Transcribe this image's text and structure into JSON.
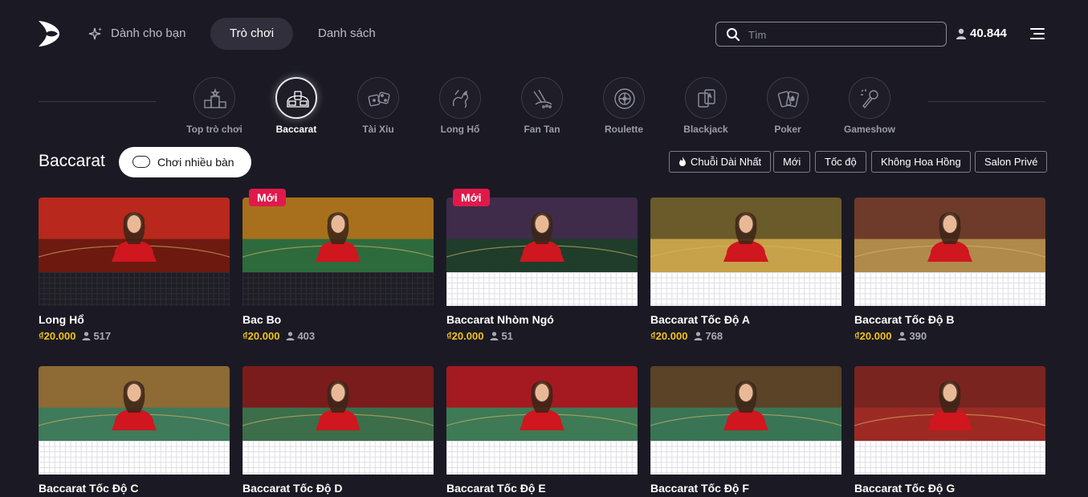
{
  "header": {
    "nav": [
      {
        "label": "Dành cho bạn",
        "active": false
      },
      {
        "label": "Trò chơi",
        "active": true
      },
      {
        "label": "Danh sách",
        "active": false
      }
    ],
    "search_placeholder": "Tìm",
    "players_total": "40.844"
  },
  "categories": [
    {
      "label": "Top trò chơi",
      "icon": "podium-icon",
      "active": false
    },
    {
      "label": "Baccarat",
      "icon": "baccarat-table-icon",
      "active": true
    },
    {
      "label": "Tài Xỉu",
      "icon": "dice-icon",
      "active": false
    },
    {
      "label": "Long Hổ",
      "icon": "dragon-icon",
      "active": false
    },
    {
      "label": "Fan Tan",
      "icon": "fan-tan-icon",
      "active": false
    },
    {
      "label": "Roulette",
      "icon": "roulette-wheel-icon",
      "active": false
    },
    {
      "label": "Blackjack",
      "icon": "blackjack-cards-icon",
      "active": false
    },
    {
      "label": "Poker",
      "icon": "poker-cards-icon",
      "active": false
    },
    {
      "label": "Gameshow",
      "icon": "microphone-icon",
      "active": false
    }
  ],
  "section": {
    "title": "Baccarat",
    "multi_table_label": "Chơi nhiều bàn",
    "filters": [
      "Chuỗi Dài Nhất",
      "Mới",
      "Tốc độ",
      "Không Hoa Hồng",
      "Salon Privé"
    ]
  },
  "tiles": [
    {
      "name": "Long Hổ",
      "price": "₫20.000",
      "players": "517",
      "badge": "",
      "road_style": "dark",
      "scene_colors": [
        "#b8281c",
        "#6e1a10"
      ]
    },
    {
      "name": "Bac Bo",
      "price": "₫20.000",
      "players": "403",
      "badge": "Mới",
      "road_style": "dark",
      "scene_colors": [
        "#a8701c",
        "#2e6b3c"
      ]
    },
    {
      "name": "Baccarat Nhòm Ngó",
      "price": "₫20.000",
      "players": "51",
      "badge": "Mới",
      "road_style": "light",
      "scene_colors": [
        "#3e2c4a",
        "#1f3d2a"
      ]
    },
    {
      "name": "Baccarat Tốc Độ A",
      "price": "₫20.000",
      "players": "768",
      "badge": "",
      "road_style": "light",
      "scene_colors": [
        "#6b5a2a",
        "#c6a24a"
      ]
    },
    {
      "name": "Baccarat Tốc Độ B",
      "price": "₫20.000",
      "players": "390",
      "badge": "",
      "road_style": "light",
      "scene_colors": [
        "#6e3a2a",
        "#b08a4a"
      ]
    },
    {
      "name": "Baccarat Tốc Độ C",
      "price": "",
      "players": "",
      "badge": "",
      "road_style": "light",
      "scene_colors": [
        "#8e6a34",
        "#3f7a5a"
      ]
    },
    {
      "name": "Baccarat Tốc Độ D",
      "price": "",
      "players": "",
      "badge": "",
      "road_style": "light",
      "scene_colors": [
        "#7a1c1c",
        "#3c6e4a"
      ]
    },
    {
      "name": "Baccarat Tốc Độ E",
      "price": "",
      "players": "",
      "badge": "",
      "road_style": "light",
      "scene_colors": [
        "#a41a20",
        "#3e7a55"
      ]
    },
    {
      "name": "Baccarat Tốc Độ F",
      "price": "",
      "players": "",
      "badge": "",
      "road_style": "light",
      "scene_colors": [
        "#5a4326",
        "#3a7555"
      ]
    },
    {
      "name": "Baccarat Tốc Độ G",
      "price": "",
      "players": "",
      "badge": "",
      "road_style": "light",
      "scene_colors": [
        "#7a2420",
        "#9c2a24"
      ]
    }
  ],
  "colors": {
    "background": "#1b1a24",
    "price": "#f1c21b",
    "badge": "#e0194b",
    "banker_red": "#e0192a",
    "player_blue": "#1a63d6",
    "tie_yellow": "#f2c81a"
  }
}
